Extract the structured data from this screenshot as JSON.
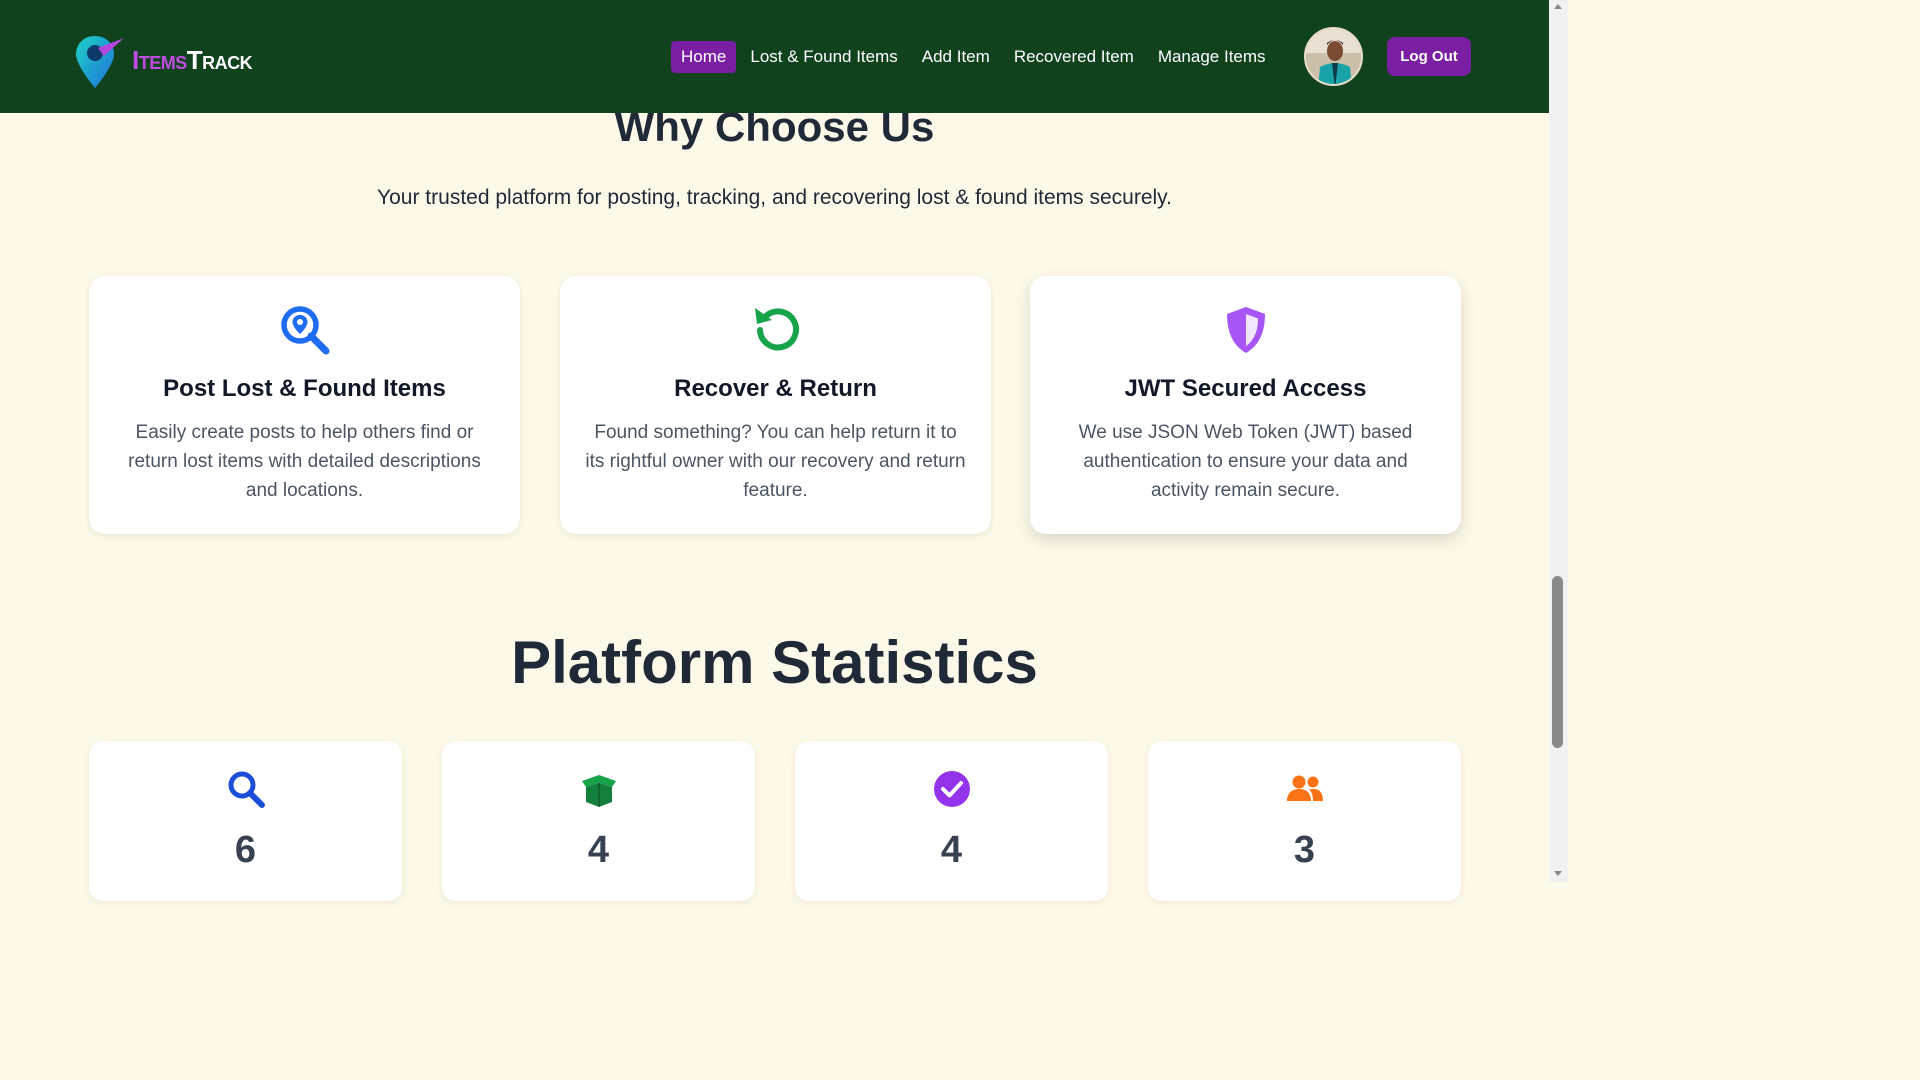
{
  "brand": {
    "name_part1": "Items",
    "name_part2": "Track"
  },
  "nav": {
    "items": [
      {
        "label": "Home",
        "active": true
      },
      {
        "label": "Lost & Found Items",
        "active": false
      },
      {
        "label": "Add Item",
        "active": false
      },
      {
        "label": "Recovered Item",
        "active": false
      },
      {
        "label": "Manage Items",
        "active": false
      }
    ],
    "logout_label": "Log Out"
  },
  "why": {
    "title": "Why Choose Us",
    "subtitle": "Your trusted platform for posting, tracking, and recovering lost & found items securely.",
    "cards": [
      {
        "icon": "search-location-icon",
        "title": "Post Lost & Found Items",
        "text": "Easily create posts to help others find or return lost items with detailed descriptions and locations."
      },
      {
        "icon": "undo-icon",
        "title": "Recover & Return",
        "text": "Found something? You can help return it to its rightful owner with our recovery and return feature."
      },
      {
        "icon": "shield-icon",
        "title": "JWT Secured Access",
        "text": "We use JSON Web Token (JWT) based authentication to ensure your data and activity remain secure."
      }
    ]
  },
  "stats": {
    "title": "Platform Statistics",
    "cards": [
      {
        "icon": "search-icon",
        "value": "6"
      },
      {
        "icon": "box-open-icon",
        "value": "4"
      },
      {
        "icon": "check-circle-icon",
        "value": "4"
      },
      {
        "icon": "users-icon",
        "value": "3"
      }
    ]
  },
  "colors": {
    "navbar": "#10421d",
    "accent": "#7b1fa2",
    "background": "#fdf9e8",
    "blue_icon": "#1d6cf2",
    "green_icon": "#16a34a",
    "purple_icon": "#a855f7",
    "orange_icon": "#f97316"
  }
}
